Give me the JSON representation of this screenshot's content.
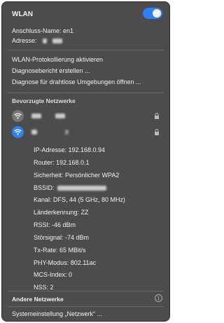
{
  "header": {
    "title": "WLAN",
    "toggle_on": true
  },
  "interface": {
    "name_label": "Anschluss-Name: en1",
    "address_label": "Adresse:"
  },
  "actions": [
    "WLAN-Protokollierung aktivieren",
    "Diagnosebericht erstellen ...",
    "Diagnose für drahtlose Umgebungen öffnen ..."
  ],
  "preferred": {
    "heading": "Bevorzugte Netzwerke"
  },
  "details": [
    "IP-Adresse: 192.168.0.94",
    "Router: 192.168.0.1",
    "Sicherheit: Persönlicher WPA2",
    "BSSID:",
    "Kanal: DFS, 44 (5 GHz, 80 MHz)",
    "Länderkennung: ZZ",
    "RSSI: -46 dBm",
    "Störsignal: -74 dBm",
    "Tx-Rate: 65 MBit/s",
    "PHY-Modus: 802.11ac",
    "MCS-Index: 0",
    "NSS: 2"
  ],
  "other_networks": "Andere Netzwerke",
  "system_prefs": "Systemeinstellung „Netzwerk“ ...",
  "colors": {
    "accent": "#2f7ff5",
    "menu_bg": "#4d4b4e"
  },
  "icons": [
    "wifi-icon",
    "lock-icon",
    "info-icon"
  ]
}
